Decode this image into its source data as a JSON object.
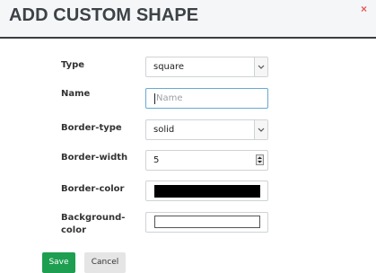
{
  "dialog": {
    "title": "ADD CUSTOM SHAPE",
    "close_glyph": "×"
  },
  "form": {
    "type": {
      "label": "Type",
      "value": "square"
    },
    "name": {
      "label": "Name",
      "placeholder": "Name",
      "value": ""
    },
    "border_type": {
      "label": "Border-type",
      "value": "solid"
    },
    "border_width": {
      "label": "Border-width",
      "value": "5"
    },
    "border_color": {
      "label": "Border-color",
      "color": "#000000"
    },
    "background_color": {
      "label_line1": "Background-",
      "label_line2": "color",
      "color": "#ffffff"
    }
  },
  "buttons": {
    "save_label": "Save",
    "cancel_label": "Cancel"
  },
  "colors": {
    "accent_green": "#1e9e50",
    "close_red": "#e35a5a",
    "focus_blue": "#67a9d6"
  },
  "icons": {
    "close": "close-icon",
    "dropdown": "chevron-down-icon",
    "spinner": "spinner-icon"
  }
}
